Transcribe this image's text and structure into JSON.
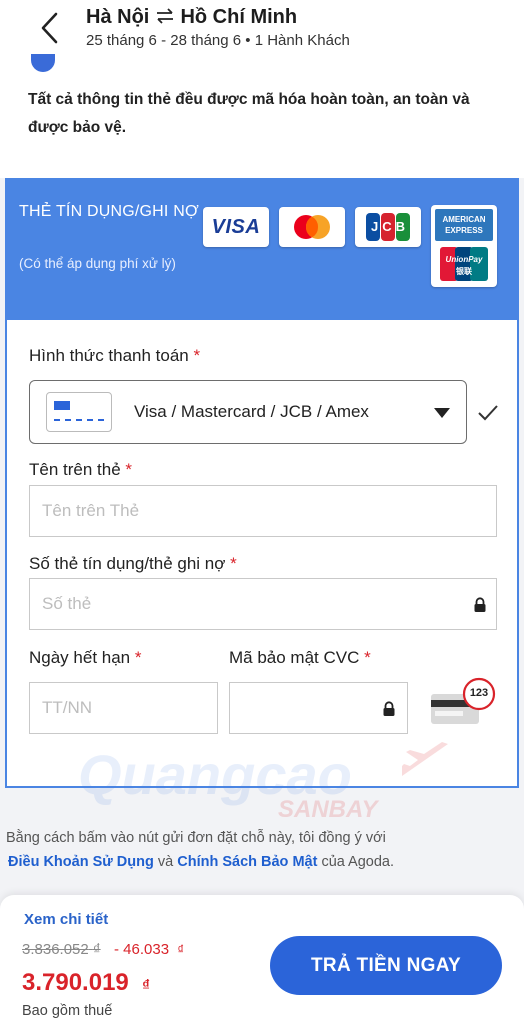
{
  "header": {
    "origin": "Hà Nội",
    "destination": "Hồ Chí Minh",
    "subtitle": "25 tháng 6 - 28 tháng 6 • 1 Hành Khách"
  },
  "notice": {
    "text": "Tất cả thông tin thẻ đều được mã hóa hoàn toàn, an toàn và được bảo vệ."
  },
  "card_section": {
    "title": "THẺ TÍN DỤNG/GHI NỢ",
    "fee_note": "(Có thể áp dụng phí xử lý)",
    "logos": {
      "visa": "VISA",
      "jcb": "JCB",
      "amex_line1": "AMERICAN",
      "amex_line2": "EXPRESS",
      "unionpay_line1": "UnionPay",
      "unionpay_line2": "银联"
    }
  },
  "form": {
    "payment_method": {
      "label": "Hình thức thanh toán",
      "required": "*",
      "value": "Visa / Mastercard / JCB / Amex"
    },
    "card_name": {
      "label": "Tên trên thẻ",
      "required": "*",
      "placeholder": "Tên trên Thẻ"
    },
    "card_number": {
      "label": "Số thẻ tín dụng/thẻ ghi nợ",
      "required": "*",
      "placeholder": "Số thẻ"
    },
    "expiry": {
      "label": "Ngày hết hạn",
      "required": "*",
      "placeholder": "TT/NN"
    },
    "cvc": {
      "label": "Mã bảo mật CVC",
      "required": "*",
      "placeholder": "",
      "hint_badge": "123"
    }
  },
  "terms": {
    "before": "Bằng cách bấm vào nút gửi đơn đặt chỗ này, tôi đồng ý với",
    "link1": "Điều Khoản Sử Dụng",
    "and": "và",
    "link2": "Chính Sách Bảo Mật",
    "after": "của Agoda."
  },
  "footer": {
    "details_link": "Xem chi tiết",
    "original_price": "3.836.052",
    "original_currency": "₫",
    "discount": "- 46.033",
    "discount_currency": "₫",
    "total": "3.790.019",
    "total_currency": "₫",
    "tax_note": "Bao gồm thuế",
    "pay_button": "TRẢ TIỀN NGAY"
  },
  "watermark": {
    "line1": "Quangcao",
    "line2": "SANBAY"
  },
  "colors": {
    "brand_blue": "#4a85e3",
    "button_blue": "#2b64d9",
    "price_red": "#d9232a",
    "link_blue": "#1f5fcf"
  }
}
